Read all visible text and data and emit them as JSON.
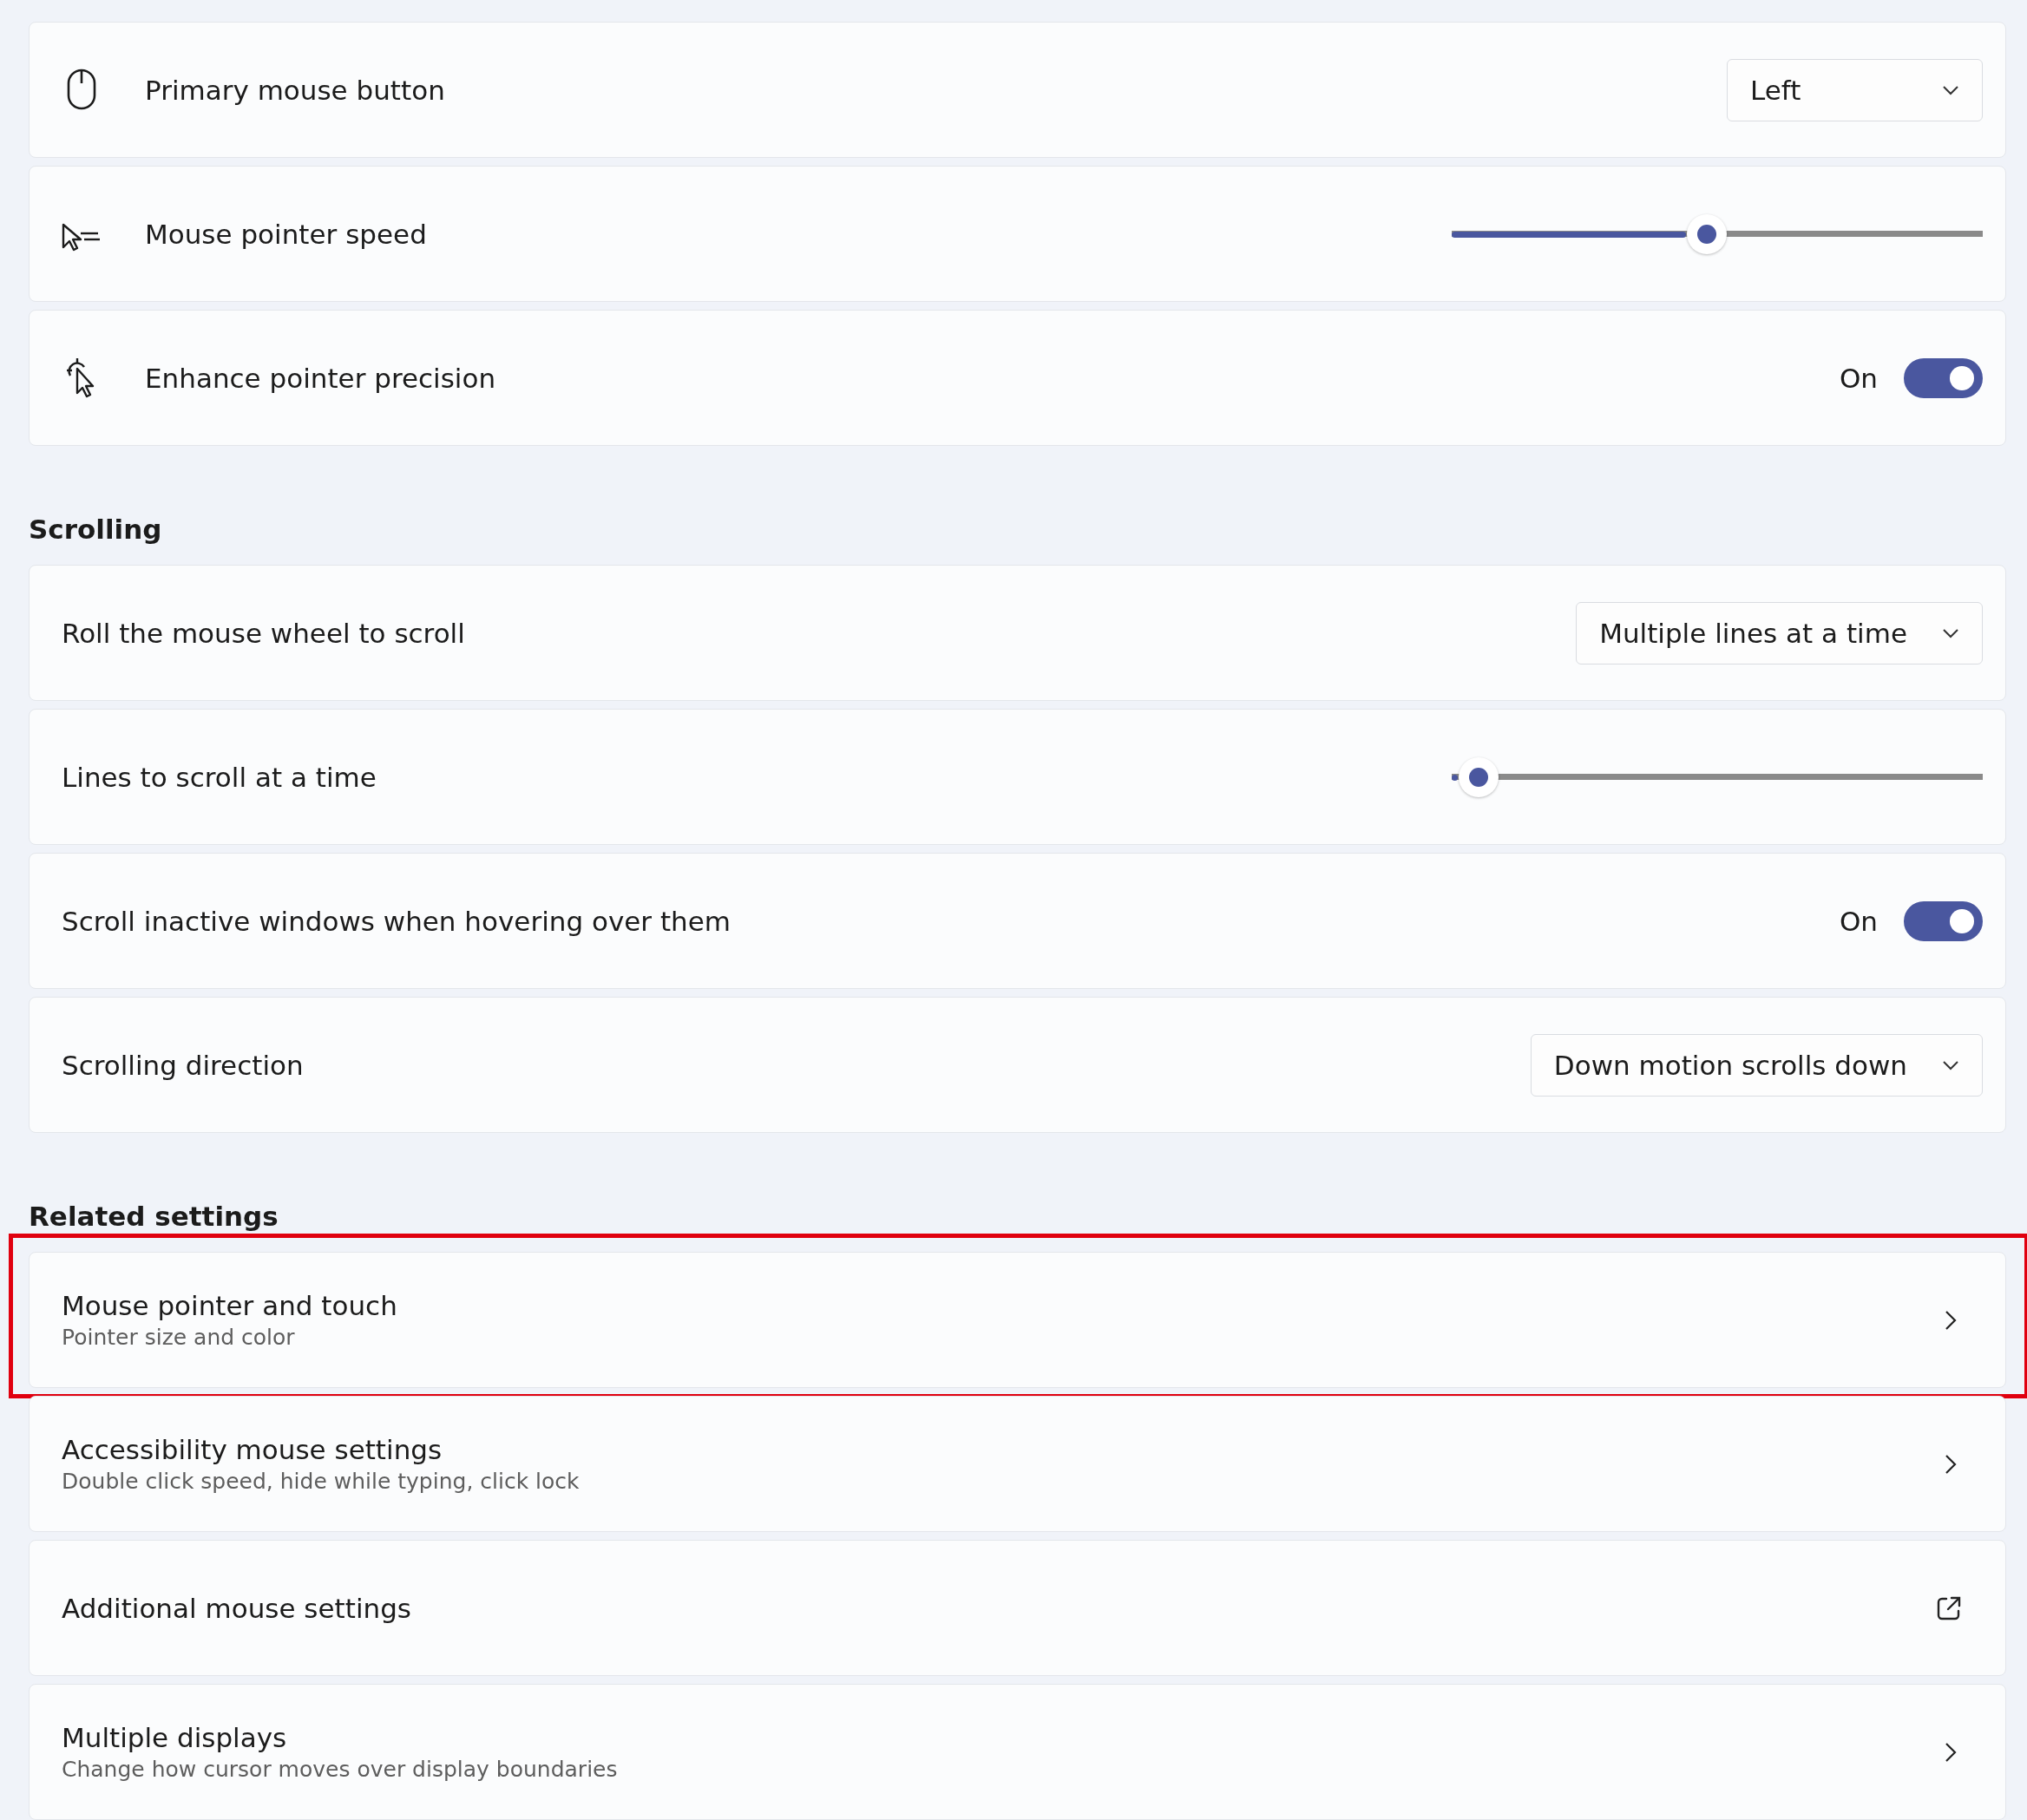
{
  "sections": [
    {
      "items": [
        {
          "kind": "dropdown",
          "label": "Primary mouse button",
          "value": "Left"
        },
        {
          "kind": "slider",
          "label": "Mouse pointer speed",
          "level": 0.48
        },
        {
          "kind": "toggle",
          "label": "Enhance pointer precision",
          "on": true,
          "state_text": "On"
        }
      ]
    },
    {
      "heading": "Scrolling",
      "items": [
        {
          "kind": "dropdown",
          "label": "Roll the mouse wheel to scroll",
          "value": "Multiple lines at a time"
        },
        {
          "kind": "slider",
          "label": "Lines to scroll at a time",
          "level": 0.05
        },
        {
          "kind": "toggle",
          "label": "Scroll inactive windows when hovering over them",
          "on": true,
          "state_text": "On"
        },
        {
          "kind": "dropdown",
          "label": "Scrolling direction",
          "value": "Down motion scrolls down"
        }
      ]
    },
    {
      "heading": "Related settings",
      "items": [
        {
          "kind": "link",
          "label": "Mouse pointer and touch",
          "subtitle": "Pointer size and color",
          "highlighted": true
        },
        {
          "kind": "link",
          "label": "Accessibility mouse settings",
          "subtitle": "Double click speed, hide while typing, click lock",
          "highlighted": false
        },
        {
          "kind": "external",
          "label": "Additional mouse settings",
          "highlighted": false
        },
        {
          "kind": "link",
          "label": "Multiple displays",
          "subtitle": "Change how cursor moves over display boundaries",
          "highlighted": false
        }
      ]
    }
  ]
}
